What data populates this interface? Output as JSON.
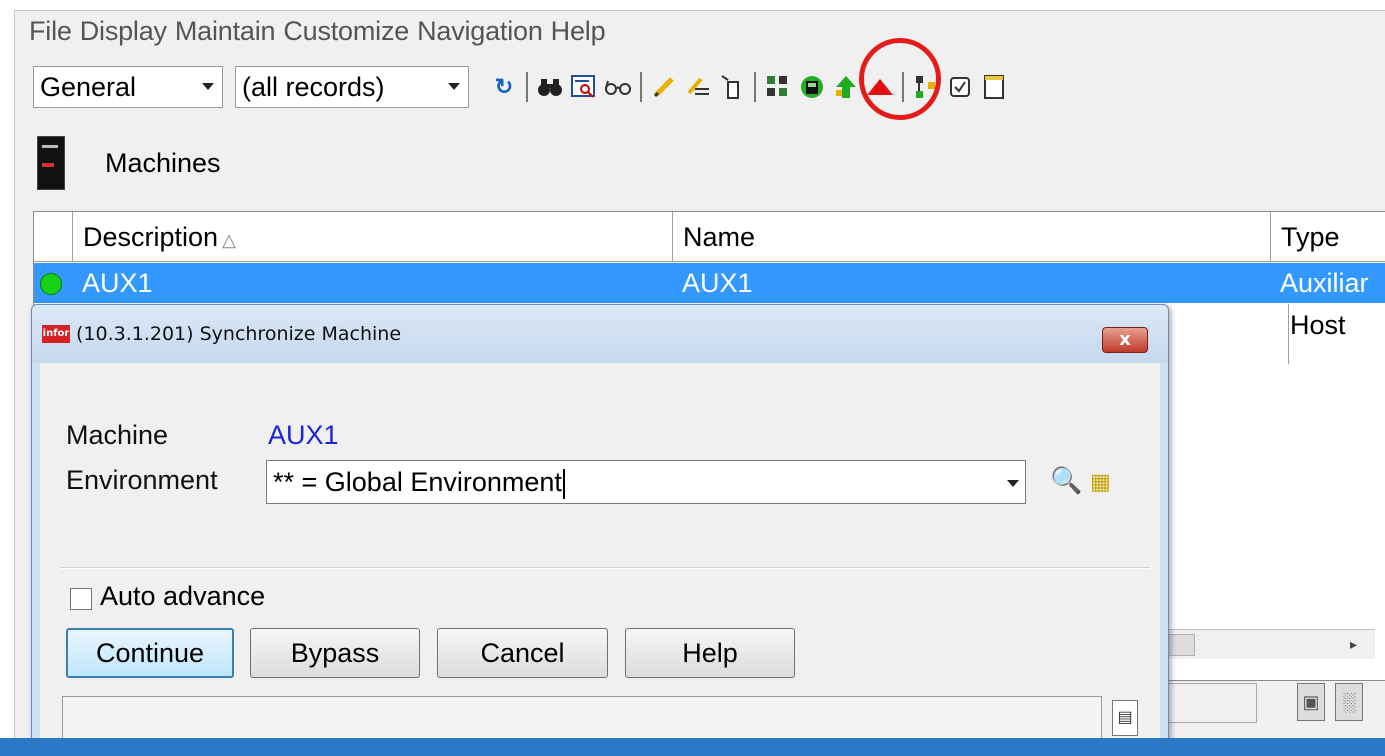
{
  "menu": [
    "File",
    "Display",
    "Maintain",
    "Customize",
    "Navigation",
    "Help"
  ],
  "toolbar": {
    "view_select": "General",
    "filter_select": "(all records)",
    "icons": [
      "refresh-icon",
      "sep",
      "binoculars-icon",
      "find-in-list-icon",
      "glasses-icon",
      "sep",
      "pencil-icon",
      "edit-lines-icon",
      "tagged-icon",
      "sep",
      "network-icon",
      "synchronize-icon",
      "green-up-arrow-icon",
      "red-triangle-icon",
      "sep",
      "tree-icon",
      "checkbox-icon",
      "notepad-icon"
    ],
    "highlight": "synchronize-icon"
  },
  "header": {
    "title": "Machines"
  },
  "grid": {
    "columns": [
      "Description",
      "Name",
      "Type"
    ],
    "rows": [
      {
        "status": "green",
        "description": "AUX1",
        "name": "AUX1",
        "type": "Auxiliar",
        "selected": true
      },
      {
        "status": "",
        "description": "",
        "name": "",
        "type": "Host",
        "selected": false
      }
    ]
  },
  "dialog": {
    "logo": "infor",
    "title": "(10.3.1.201) Synchronize Machine",
    "close_label": "x",
    "machine_label": "Machine",
    "machine_value": "AUX1",
    "environment_label": "Environment",
    "environment_value": "** = Global Environment",
    "auto_advance_label": "Auto advance",
    "auto_advance_checked": false,
    "buttons": {
      "continue": "Continue",
      "bypass": "Bypass",
      "cancel": "Cancel",
      "help": "Help"
    },
    "status_text": ""
  },
  "colors": {
    "selection": "#3399ff",
    "link_value": "#1a24d8",
    "highlight_ring": "#e31b1b"
  }
}
